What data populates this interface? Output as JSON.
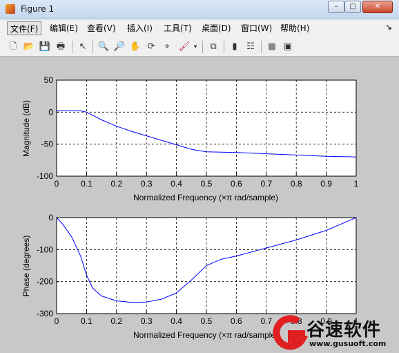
{
  "window": {
    "title": "Figure 1",
    "min": "–",
    "max": "□",
    "close": "✕"
  },
  "menu": [
    "文件(F)",
    "编辑(E)",
    "查看(V)",
    "插入(I)",
    "工具(T)",
    "桌面(D)",
    "窗口(W)",
    "帮助(H)"
  ],
  "menu_more": "↘",
  "toolbar": [
    "new-figure-icon",
    "open-file-icon",
    "save-icon",
    "print-icon",
    "select-arrow-icon",
    "zoom-in-icon",
    "zoom-out-icon",
    "pan-hand-icon",
    "rotate-3d-icon",
    "data-cursor-icon",
    "brush-icon",
    "dropdown-arrow-icon",
    "link-plot-icon",
    "colorbar-icon",
    "legend-icon",
    "hide-plot-tools-icon",
    "show-plot-tools-icon"
  ],
  "chart_data": [
    {
      "type": "line",
      "xlabel": "Normalized Frequency  (×π rad/sample)",
      "ylabel": "Magnitude (dB)",
      "xlim": [
        0,
        1
      ],
      "ylim": [
        -100,
        50
      ],
      "xticks": [
        "0",
        "0.1",
        "0.2",
        "0.3",
        "0.4",
        "0.5",
        "0.6",
        "0.7",
        "0.8",
        "0.9",
        "1"
      ],
      "yticks": [
        "50",
        "0",
        "-50",
        "-100"
      ],
      "grid": true,
      "line_color": "#0000ff",
      "x": [
        0,
        0.05,
        0.08,
        0.1,
        0.15,
        0.2,
        0.25,
        0.3,
        0.35,
        0.4,
        0.45,
        0.5,
        0.6,
        0.7,
        0.8,
        0.9,
        1.0
      ],
      "y": [
        2,
        2,
        2,
        0,
        -12,
        -22,
        -30,
        -37,
        -44,
        -51,
        -58,
        -62,
        -63,
        -65,
        -67,
        -69,
        -70
      ]
    },
    {
      "type": "line",
      "xlabel": "Normalized Frequency  (×π rad/sample)",
      "ylabel": "Phase (degrees)",
      "xlim": [
        0,
        1
      ],
      "ylim": [
        -300,
        0
      ],
      "xticks": [
        "0",
        "0.1",
        "0.2",
        "0.3",
        "0.4",
        "0.5",
        "0.6",
        "0.7",
        "0.8",
        "0.9",
        "1"
      ],
      "yticks": [
        "0",
        "-100",
        "-200",
        "-300"
      ],
      "grid": true,
      "line_color": "#0000ff",
      "x": [
        0,
        0.02,
        0.05,
        0.08,
        0.1,
        0.12,
        0.15,
        0.2,
        0.25,
        0.3,
        0.35,
        0.4,
        0.45,
        0.5,
        0.55,
        0.6,
        0.7,
        0.8,
        0.9,
        1.0
      ],
      "y": [
        0,
        -20,
        -60,
        -120,
        -180,
        -220,
        -245,
        -260,
        -265,
        -264,
        -255,
        -235,
        -195,
        -150,
        -130,
        -120,
        -95,
        -70,
        -40,
        0
      ]
    }
  ],
  "watermark": {
    "text": "谷速软件",
    "url": "www.gusuoft.com"
  }
}
